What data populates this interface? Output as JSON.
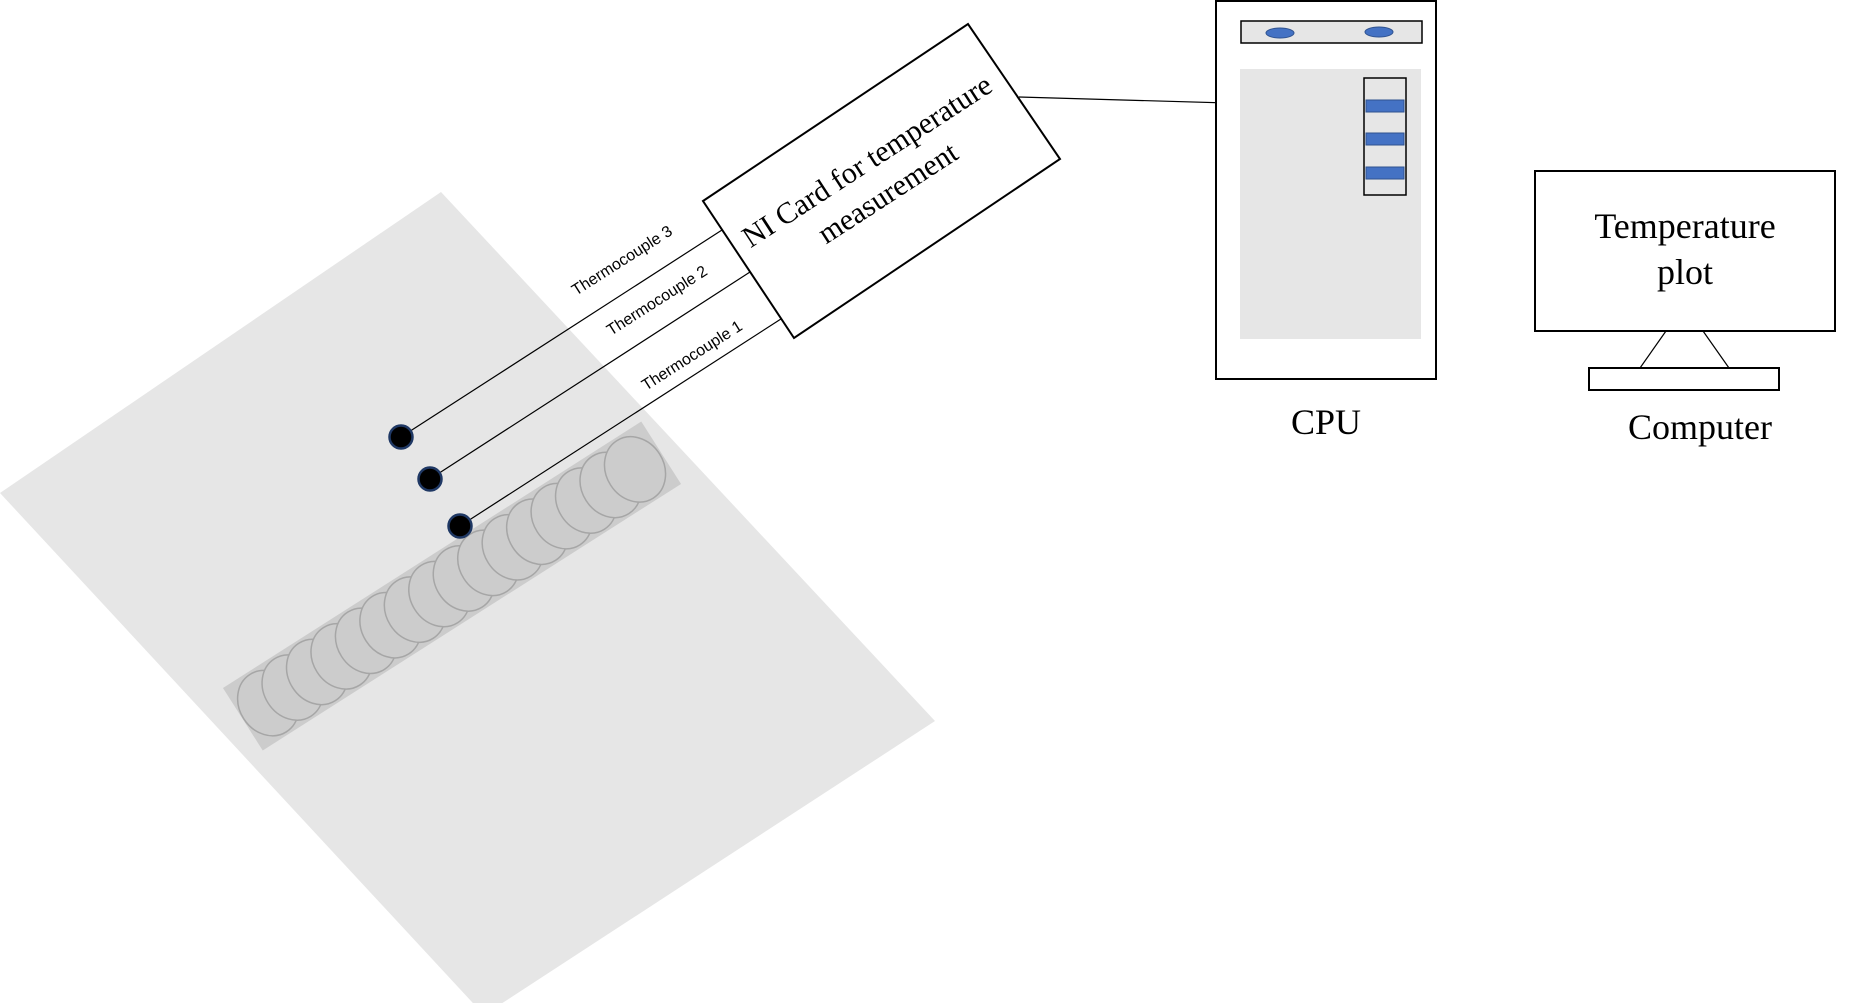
{
  "ni_card": {
    "line1": "NI Card for temperature",
    "line2": "measurement"
  },
  "thermocouples": [
    {
      "label": "Thermocouple 3"
    },
    {
      "label": "Thermocouple 2"
    },
    {
      "label": "Thermocouple 1"
    }
  ],
  "cpu": {
    "label": "CPU"
  },
  "computer": {
    "screen_line1": "Temperature",
    "screen_line2": "plot",
    "label": "Computer"
  },
  "colors": {
    "plate": "#e6e6e6",
    "weld": "#cccccc",
    "accent_blue": "#4472c4",
    "probe": "#000000"
  }
}
